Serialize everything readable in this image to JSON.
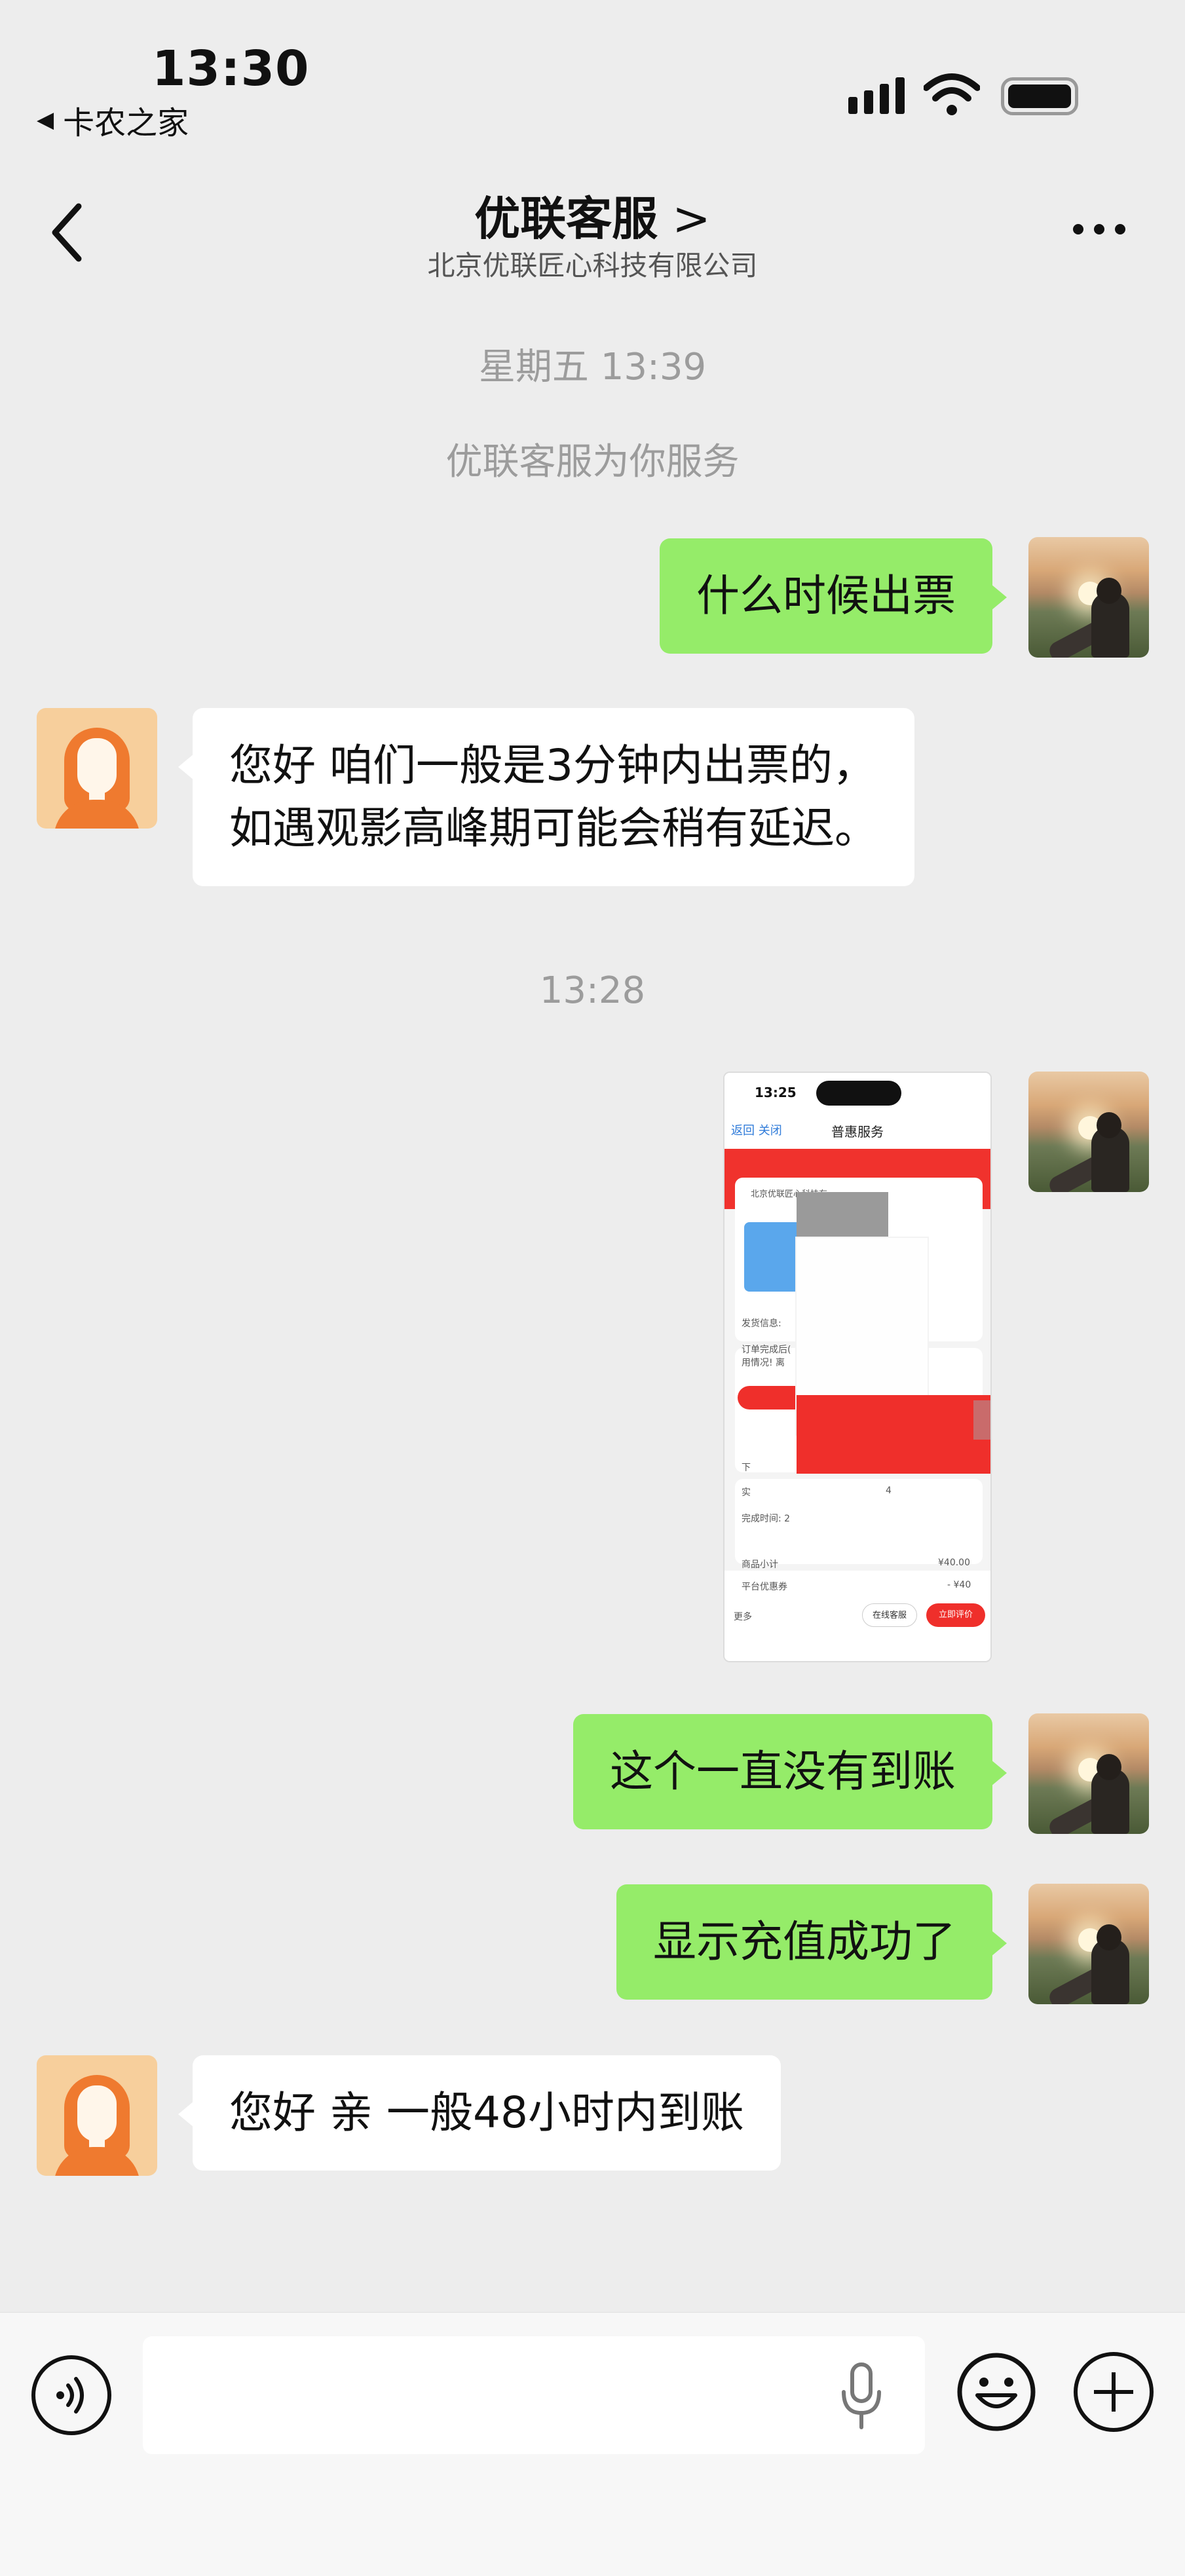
{
  "status_bar": {
    "time": "13:30",
    "back_app": "卡农之家",
    "back_app_icon": "back-triangle-icon",
    "icons": [
      "signal-icon",
      "wifi-icon",
      "battery-icon"
    ]
  },
  "nav": {
    "title": "优联客服",
    "title_chevron": ">",
    "subtitle": "北京优联匠心科技有限公司",
    "back_icon": "chevron-left-icon",
    "more_icon": "more-dots-icon"
  },
  "chat": {
    "system_messages": [
      "星期五 13:39",
      "优联客服为你服务",
      "13:28"
    ],
    "messages": [
      {
        "sender": "me",
        "type": "text",
        "text": "什么时候出票"
      },
      {
        "sender": "service",
        "type": "text",
        "text": "您好  咱们一般是3分钟内出票的，\n如遇观影高峰期可能会稍有延迟。"
      },
      {
        "sender": "me",
        "type": "image",
        "alt": "订单截图"
      },
      {
        "sender": "me",
        "type": "text",
        "text": "这个一直没有到账"
      },
      {
        "sender": "me",
        "type": "text",
        "text": "显示充值成功了"
      },
      {
        "sender": "service",
        "type": "text",
        "text": "您好  亲  一般48小时内到账"
      }
    ],
    "screenshot": {
      "time": "13:25",
      "nav_title": "普惠服务",
      "nav_back": "返回  关闭",
      "company": "北京优联匠心科技有",
      "rows": [
        "发货信息:",
        "订单完成后(",
        "用情况! 离",
        "下",
        "2",
        "实",
        "4",
        "完成时间: 2",
        "商品小计",
        "¥40.00",
        "平台优惠券",
        "- ¥40",
        "更多"
      ],
      "buttons": [
        "在线客服",
        "立即评价"
      ]
    }
  },
  "input_bar": {
    "voice_icon": "voice-icon",
    "mic_icon": "microphone-icon",
    "emoji_icon": "emoji-icon",
    "plus_icon": "plus-icon",
    "placeholder": ""
  }
}
